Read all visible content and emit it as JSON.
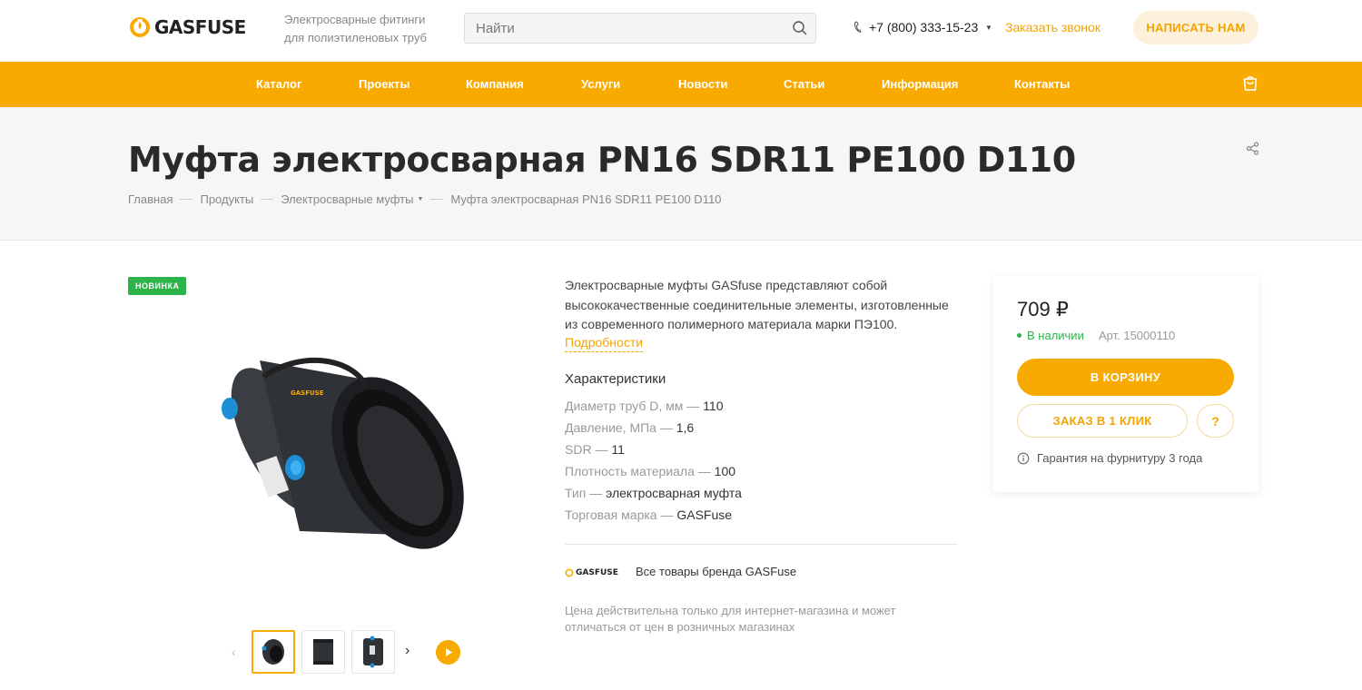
{
  "header": {
    "logo_text": "GASFUSE",
    "slogan": "Электросварные фитинги для полиэтиленовых труб",
    "search_placeholder": "Найти",
    "phone": "+7 (800) 333-15-23",
    "callback_label": "Заказать звонок",
    "write_button": "НАПИСАТЬ НАМ"
  },
  "nav": {
    "items": [
      "Каталог",
      "Проекты",
      "Компания",
      "Услуги",
      "Новости",
      "Статьи",
      "Информация",
      "Контакты"
    ]
  },
  "page": {
    "title": "Муфта электросварная PN16 SDR11 PE100 D110",
    "breadcrumb": [
      "Главная",
      "Продукты",
      "Электросварные муфты",
      "Муфта электросварная PN16 SDR11 PE100 D110"
    ]
  },
  "product": {
    "badge": "НОВИНКА",
    "description": "Электросварные муфты GASfuse представляют собой высококачественные соединительные элементы, изготовленные из современного полимерного материала марки ПЭ100.",
    "more_link": "Подробности",
    "specs_title": "Характеристики",
    "specs": [
      {
        "key": "Диаметр труб D, мм",
        "value": "110"
      },
      {
        "key": "Давление, МПа",
        "value": "1,6"
      },
      {
        "key": "SDR",
        "value": "11"
      },
      {
        "key": "Плотность материала",
        "value": "100"
      },
      {
        "key": "Тип",
        "value": "электросварная муфта"
      },
      {
        "key": "Торговая марка",
        "value": "GASFuse"
      }
    ],
    "spec_separator": "—",
    "brand_logo_text": "GASFUSE",
    "brand_link": "Все товары бренда GASFuse",
    "price_note": "Цена действительна только для интернет-магазина и может отличаться от цен в розничных магазинах"
  },
  "buy": {
    "price": "709 ₽",
    "stock": "В наличии",
    "sku": "Арт. 15000110",
    "cart_button": "В КОРЗИНУ",
    "oneclick_button": "ЗАКАЗ В 1 КЛИК",
    "question_button": "?",
    "warranty": "Гарантия на фурнитуру 3 года"
  },
  "colors": {
    "accent": "#f9aa00",
    "accent_text": "#f5a300",
    "stock_green": "#2cb34a"
  }
}
